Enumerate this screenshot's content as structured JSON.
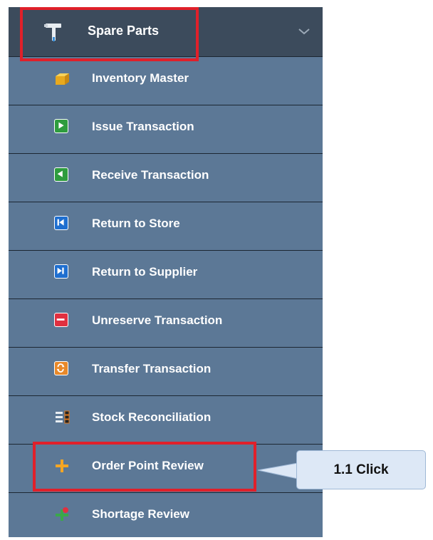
{
  "menu": {
    "header": {
      "title": "Spare Parts",
      "icon": "hammer-icon",
      "expand_icon": "chevron-down-icon"
    },
    "items": [
      {
        "label": "Inventory Master",
        "icon": "box-icon"
      },
      {
        "label": "Issue Transaction",
        "icon": "play-right-icon"
      },
      {
        "label": "Receive Transaction",
        "icon": "play-left-icon"
      },
      {
        "label": "Return to Store",
        "icon": "skip-back-icon"
      },
      {
        "label": "Return to Supplier",
        "icon": "skip-forward-icon"
      },
      {
        "label": "Unreserve Transaction",
        "icon": "minus-icon"
      },
      {
        "label": "Transfer Transaction",
        "icon": "transfer-icon"
      },
      {
        "label": "Stock Reconciliation",
        "icon": "reconciliation-icon"
      },
      {
        "label": "Order Point Review",
        "icon": "plus-icon"
      },
      {
        "label": "Shortage Review",
        "icon": "shortage-icon"
      }
    ]
  },
  "callout": {
    "text": "1.1 Click"
  },
  "colors": {
    "menu_bg": "#5c7896",
    "header_bg": "#3c4b5c",
    "highlight": "#e0202a",
    "callout_bg": "#dde8f6"
  }
}
